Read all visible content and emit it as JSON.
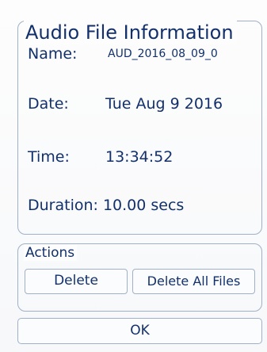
{
  "dialog": {
    "title": "Audio File Information",
    "name_label": "Name:",
    "name_value": "AUD_2016_08_09_0",
    "date_label": "Date:",
    "date_value": "Tue Aug 9 2016",
    "time_label": "Time:",
    "time_value": "13:34:52",
    "duration_text": "Duration: 10.00 secs"
  },
  "actions": {
    "title": "Actions",
    "delete_label": "Delete",
    "delete_all_label": "Delete All Files"
  },
  "footer": {
    "ok_label": "OK"
  },
  "colors": {
    "text": "#12306b",
    "border": "#9fb0c8",
    "background": "#fdfdfd"
  }
}
